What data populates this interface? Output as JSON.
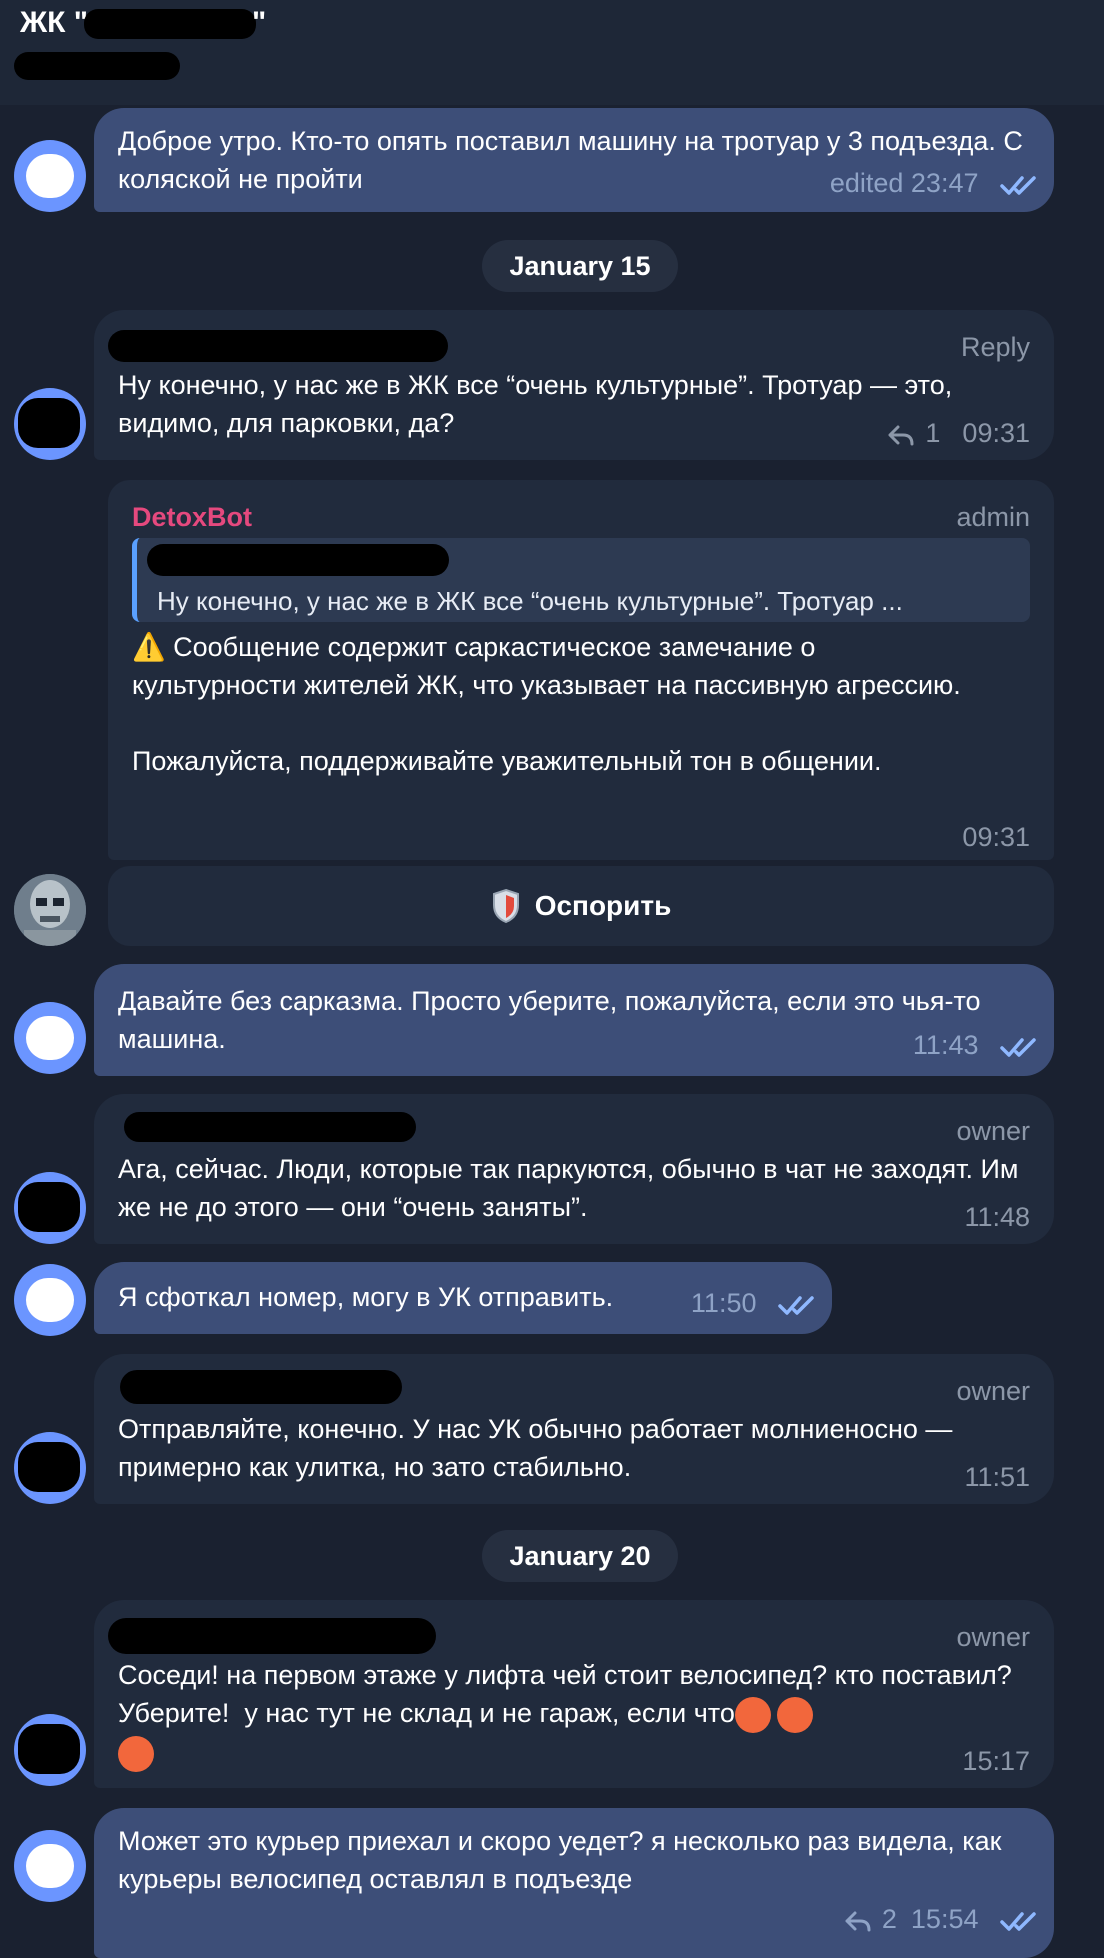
{
  "header": {
    "title": "ЖК \"",
    "title_end": "\""
  },
  "dates": [
    "January 15",
    "January 20"
  ],
  "messages": [
    {
      "text": "Доброе утро. Кто-то опять поставил машину на тротуар у 3 подъезда. С коляской не пройти",
      "meta": "edited 23:47"
    },
    {
      "role": "Reply",
      "text": "Ну конечно, у нас же в ЖК все “очень культурные”. Тротуар — это, видимо, для парковки, да?",
      "reply_count": "1",
      "time": "09:31"
    },
    {
      "sender": "DetoxBot",
      "role": "admin",
      "quote": "Ну конечно, у нас же в ЖК все “очень культурные”. Тротуар ...",
      "warning_icon": "⚠️",
      "text": "Сообщение содержит саркастическое замечание о культурности жителей ЖК, что указывает на пассивную агрессию.\n\nПожалуйста, поддерживайте уважительный тон в общении.",
      "time": "09:31",
      "button_label": "Оспорить"
    },
    {
      "text": "Давайте без сарказма. Просто уберите, пожалуйста, если это чья-то машина.",
      "time": "11:43"
    },
    {
      "role": "owner",
      "text": "Ага, сейчас. Люди, которые так паркуются, обычно в чат не заходят. Им же не до этого — они “очень заняты”.",
      "time": "11:48"
    },
    {
      "text": "Я сфоткал номер, могу в УК отправить.",
      "time": "11:50"
    },
    {
      "role": "owner",
      "text": "Отправляйте, конечно. У нас УК обычно работает молниеносно — примерно как улитка, но зато стабильно.",
      "time": "11:51"
    },
    {
      "role": "owner",
      "text": "Соседи! на первом этаже у лифта чей стоит велосипед? кто поставил? Уберите!  у нас тут не склад и не гараж, если что",
      "time": "15:17"
    },
    {
      "text": "Может это курьер приехал и скоро уедет? я несколько раз видела, как курьеры велосипед оставлял в подъезде",
      "reply_count": "2",
      "time": "15:54"
    }
  ],
  "colors": {
    "background": "#1a2130",
    "outgoing_bubble": "#3d4e78",
    "incoming_bubble": "#212b3d",
    "bot_name": "#e5497e",
    "avatar": "#6b95ff"
  }
}
